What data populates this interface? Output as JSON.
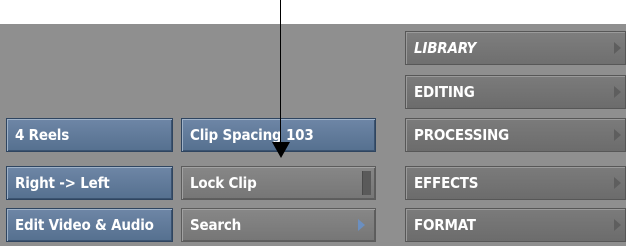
{
  "left_column": {
    "reels": "4 Reels",
    "direction": "Right -> Left",
    "edit_mode": "Edit Video & Audio"
  },
  "middle_column": {
    "clip_spacing": "Clip Spacing 103",
    "lock_clip": "Lock Clip",
    "search": "Search"
  },
  "menu": {
    "library": "LIBRARY",
    "editing": "EDITING",
    "processing": "PROCESSING",
    "effects": "EFFECTS",
    "format": "FORMAT"
  },
  "colors": {
    "panel": "#8f8f8f",
    "blue_button": "#62799a",
    "grey_button": "#7d7d7d",
    "menu_button": "#737373"
  }
}
